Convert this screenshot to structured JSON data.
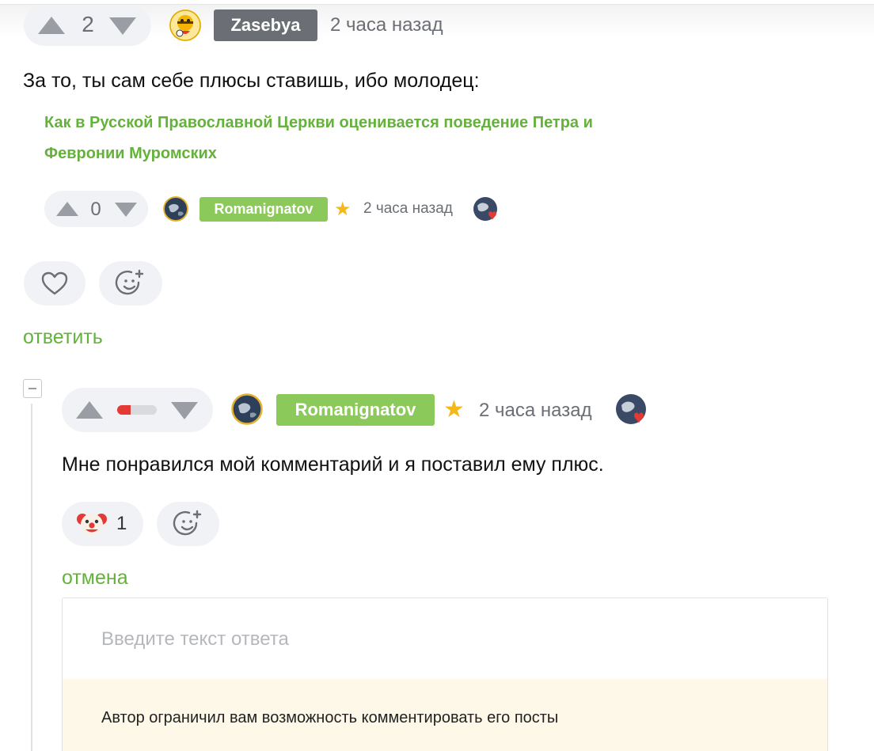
{
  "comment1": {
    "score": "2",
    "author": "Zasebya",
    "time": "2 часа назад",
    "text": "За то, ты сам себе плюсы ставишь, ибо молодец:",
    "quoted": {
      "title_line1": "Как в Русской Православной Церкви оценивается поведение Петра и",
      "title_line2": "Февронии Муромских",
      "score": "0",
      "author": "Romanignatov",
      "time": "2 часа назад"
    },
    "reply_label": "ответить"
  },
  "comment2": {
    "author": "Romanignatov",
    "time": "2 часа назад",
    "text": "Мне понравился мой комментарий и я поставил ему плюс.",
    "reaction_count": "1",
    "cancel_label": "отмена"
  },
  "reply_form": {
    "placeholder": "Введите текст ответа",
    "notice": "Автор ограничил вам возможность комментировать его посты"
  },
  "icons": {
    "upvote": "triangle-up-icon",
    "downvote": "triangle-down-icon",
    "like": "heart-icon",
    "add_reaction": "smiley-plus-icon",
    "reaction": "clown-face-icon",
    "collapse": "minus-box-icon",
    "star": "star-icon"
  },
  "colors": {
    "accent_green": "#64b23b",
    "badge_green": "#8cc95b",
    "badge_gray": "#6b6e74",
    "star": "#f3b91a",
    "notice_bg": "#fdf8e8"
  }
}
